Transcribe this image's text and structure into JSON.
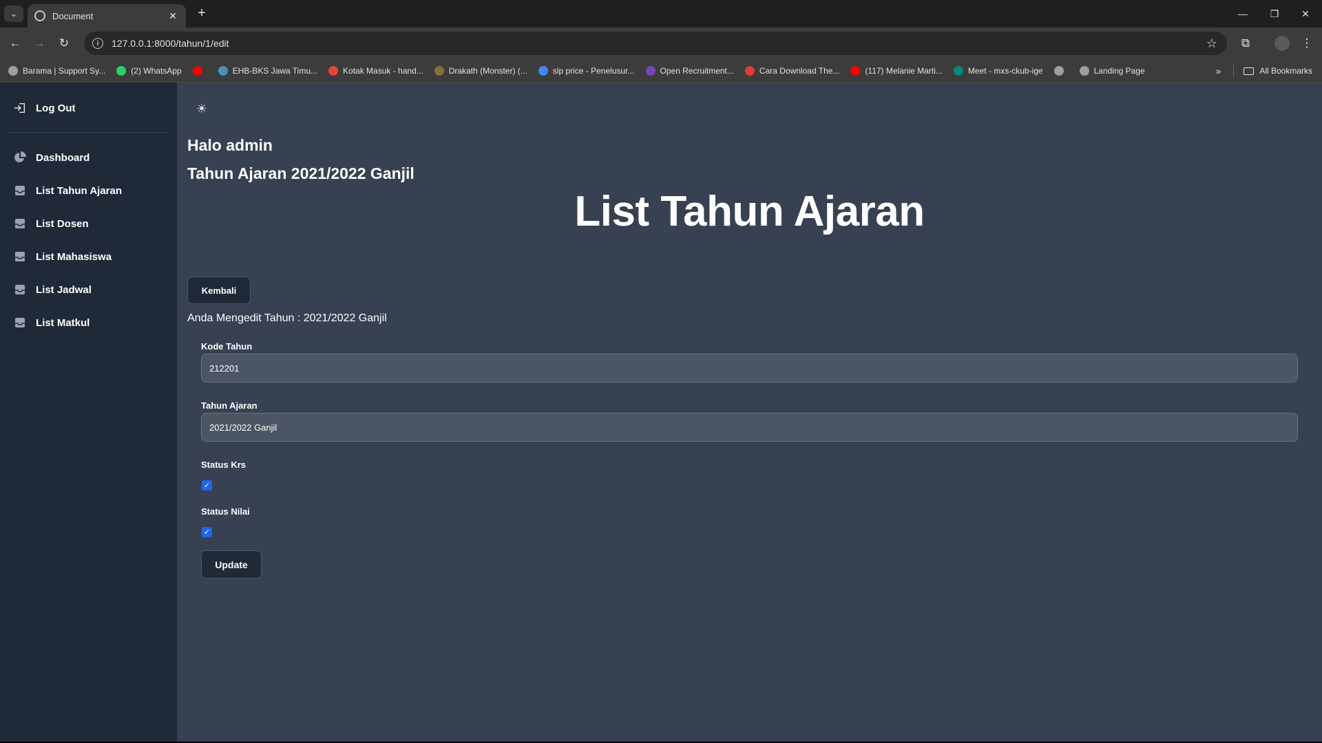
{
  "browser": {
    "tab_title": "Document",
    "url": "127.0.0.1:8000/tahun/1/edit",
    "bookmarks": [
      {
        "label": "Barama | Support Sy...",
        "icon": "globe-icon",
        "color": "#9aa0a6"
      },
      {
        "label": "(2) WhatsApp",
        "icon": "whatsapp-icon",
        "color": "#25d366"
      },
      {
        "label": "",
        "icon": "youtube-icon",
        "color": "#ff0000"
      },
      {
        "label": "EHB-BKS Jawa Timu...",
        "icon": "site-icon",
        "color": "#4a90c2"
      },
      {
        "label": "Kotak Masuk - hand...",
        "icon": "gmail-icon",
        "color": "#ea4335"
      },
      {
        "label": "Drakath (Monster) (...",
        "icon": "site-icon",
        "color": "#8a6d3b"
      },
      {
        "label": "slp price - Penelusur...",
        "icon": "google-icon",
        "color": "#4285f4"
      },
      {
        "label": "Open Recruitment...",
        "icon": "forms-icon",
        "color": "#7248b9"
      },
      {
        "label": "Cara Download The...",
        "icon": "site-icon",
        "color": "#e53935"
      },
      {
        "label": "(117) Melanie Marti...",
        "icon": "youtube-icon",
        "color": "#ff0000"
      },
      {
        "label": "Meet - mxs-ckub-ige",
        "icon": "meet-icon",
        "color": "#00897b"
      },
      {
        "label": "",
        "icon": "globe-icon",
        "color": "#9aa0a6"
      },
      {
        "label": "Landing Page",
        "icon": "globe-icon",
        "color": "#9aa0a6"
      }
    ],
    "all_bookmarks": "All Bookmarks"
  },
  "sidebar": {
    "logout": "Log Out",
    "items": [
      {
        "label": "Dashboard"
      },
      {
        "label": "List Tahun Ajaran"
      },
      {
        "label": "List Dosen"
      },
      {
        "label": "List Mahasiswa"
      },
      {
        "label": "List Jadwal"
      },
      {
        "label": "List Matkul"
      }
    ]
  },
  "main": {
    "greeting": "Halo admin",
    "term": "Tahun Ajaran 2021/2022 Ganjil",
    "title": "List Tahun Ajaran",
    "back_label": "Kembali",
    "edit_note": "Anda Mengedit Tahun : 2021/2022 Ganjil"
  },
  "form": {
    "kode_label": "Kode Tahun",
    "kode_value": "212201",
    "tahun_label": "Tahun Ajaran",
    "tahun_value": "2021/2022 Ganjil",
    "krs_label": "Status Krs",
    "krs_checked": true,
    "nilai_label": "Status Nilai",
    "nilai_checked": true,
    "update_label": "Update"
  },
  "colors": {
    "sidebar_bg": "#1f2937",
    "main_bg": "#374151",
    "input_bg": "#4b5563",
    "checkbox_accent": "#2563eb"
  }
}
